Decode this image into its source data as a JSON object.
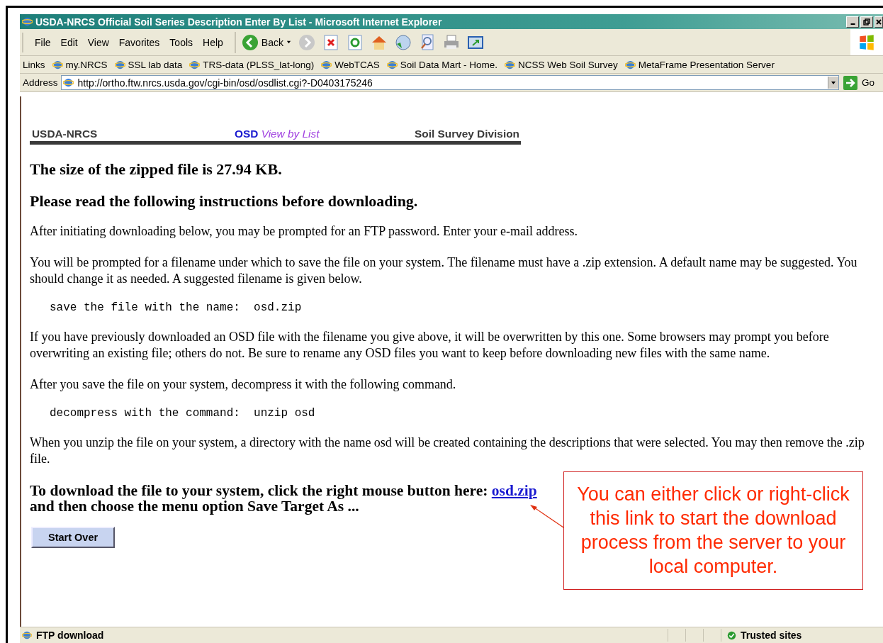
{
  "window": {
    "title": "USDA-NRCS Official Soil Series Description Enter By List - Microsoft Internet Explorer"
  },
  "menu": [
    "File",
    "Edit",
    "View",
    "Favorites",
    "Tools",
    "Help"
  ],
  "toolbar": {
    "back_label": "Back"
  },
  "links_bar": {
    "label": "Links",
    "items": [
      "my.NRCS",
      "SSL lab data",
      "TRS-data (PLSS_lat-long)",
      "WebTCAS",
      "Soil Data Mart - Home.",
      "NCSS Web Soil Survey",
      "MetaFrame Presentation Server"
    ]
  },
  "address_bar": {
    "label": "Address",
    "url": "http://ortho.ftw.nrcs.usda.gov/cgi-bin/osd/osdlist.cgi?-D0403175246",
    "go_label": "Go"
  },
  "page": {
    "header": {
      "left": "USDA-NRCS",
      "center_osd": "OSD",
      "center_rest": "View by List",
      "right": "Soil Survey Division"
    },
    "blocks": [
      {
        "kind": "heading",
        "text": "The size of the zipped file is 27.94 KB."
      },
      {
        "kind": "heading",
        "text": "Please read the following instructions before downloading."
      },
      {
        "kind": "paragraph",
        "text": "After initiating downloading below, you may be prompted for an FTP password. Enter your e-mail address."
      },
      {
        "kind": "paragraph",
        "text": "You will be prompted for a filename under which to save the file on your system. The filename must have a .zip extension. A default name may be suggested. You should change it as needed. A suggested filename is given below."
      },
      {
        "kind": "code",
        "text": "save the file with the name:  osd.zip"
      },
      {
        "kind": "paragraph",
        "text": "If you have previously downloaded an OSD file with the filename you give above, it will be overwritten by this one. Some browsers may prompt you before overwriting an existing file; others do not. Be sure to rename any OSD files you want to keep before downloading new files with the same name."
      },
      {
        "kind": "paragraph",
        "text": "After you save the file on your system, decompress it with the following command."
      },
      {
        "kind": "code",
        "text": "decompress with the command:  unzip osd"
      },
      {
        "kind": "paragraph",
        "text": "When you unzip the file on your system, a directory with the name osd will be created containing the descriptions that were selected. You may then remove the .zip file."
      }
    ],
    "download": {
      "before": "To download the file to your system, click the right mouse button here:",
      "link": "osd.zip",
      "after": "and then choose the menu option Save Target As ..."
    },
    "button": "Start Over"
  },
  "callout": "You can either click or right-click this link to start the download process from the server to your local computer.",
  "status_bar": {
    "text": "FTP download",
    "zone": "Trusted sites"
  }
}
